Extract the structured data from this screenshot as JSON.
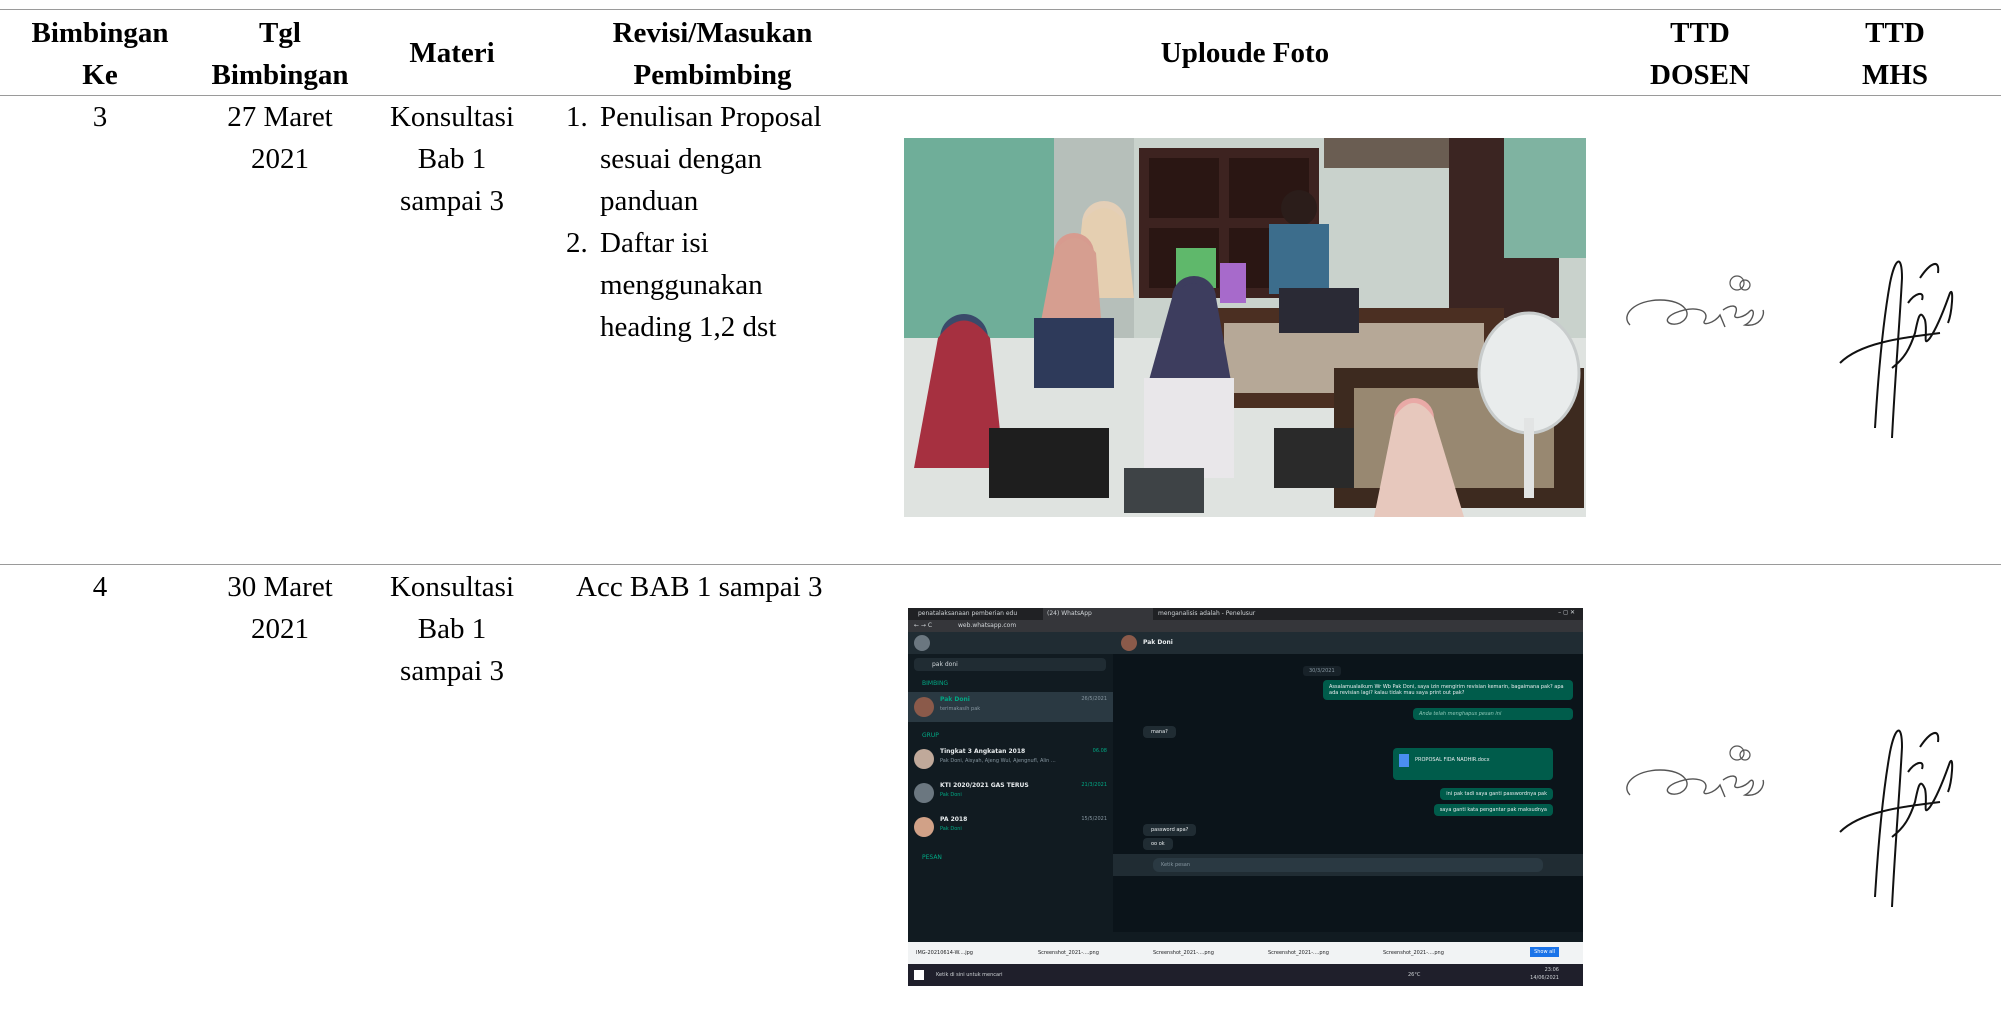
{
  "table": {
    "headers": {
      "ke": [
        "Bimbingan",
        "Ke"
      ],
      "tgl": [
        "Tgl",
        "Bimbingan"
      ],
      "materi": "Materi",
      "revisi": [
        "Revisi/Masukan",
        "Pembimbing"
      ],
      "foto": "Uploude Foto",
      "ttd_dosen": [
        "TTD",
        "DOSEN"
      ],
      "ttd_mhs": [
        "TTD",
        "MHS"
      ]
    },
    "rows": [
      {
        "ke": "3",
        "tgl": [
          "27 Maret",
          "2021"
        ],
        "materi": [
          "Konsultasi",
          "Bab 1",
          "sampai 3"
        ],
        "revisi": [
          {
            "num": "1.",
            "lines": [
              "Penulisan Proposal",
              "sesuai dengan",
              "panduan"
            ]
          },
          {
            "num": "2.",
            "lines": [
              "Daftar isi",
              "menggunakan",
              "heading 1,2 dst"
            ]
          }
        ],
        "photo_icon": "group-study-photo"
      },
      {
        "ke": "4",
        "tgl": [
          "30 Maret",
          "2021"
        ],
        "materi": [
          "Konsultasi",
          "Bab 1",
          "sampai 3"
        ],
        "revisi_text": "Acc BAB 1 sampai 3",
        "photo_icon": "whatsapp-chat-screenshot"
      }
    ]
  },
  "whatsapp": {
    "tabs": [
      "penatalaksanaan pemberian edu",
      "(24) WhatsApp",
      "menganalisis adalah - Penelusur"
    ],
    "url": "web.whatsapp.com",
    "search": "pak doni",
    "contact_name": "Pak Doni",
    "date_chip": "30/3/2021",
    "section_bimbing": "BIMBING",
    "section_grup": "GRUP",
    "section_pesan": "PESAN",
    "chats": [
      {
        "name": "Pak Doni",
        "preview": "terimakasih pak",
        "time": "26/5/2021"
      },
      {
        "name": "Tingkat 3 Angkatan 2018",
        "preview": "Pak Doni, Aisyah, Ajeng Wul, Ajengnufl, Alin ...",
        "time": "06.08"
      },
      {
        "name": "KTI 2020/2021 GAS TERUS",
        "preview": "Pak Doni",
        "time": "21/3/2021"
      },
      {
        "name": "PA 2018",
        "preview": "Pak Doni",
        "time": "15/5/2021"
      }
    ],
    "msg_out_1": "Assalamualaikum Wr Wb Pak Doni, saya izin mengirim revisian kemarin, bagaimana pak? apa ada revisian lagi? kalau tidak mau saya print out pak?",
    "msg_deleted": "Anda telah menghapus pesan ini",
    "msg_in_1": "mana?",
    "file_name": "PROPOSAL FIDA NADHIR.docx",
    "msg_out_2": "ini pak tadi saya ganti passwordnya pak",
    "msg_out_3": "saya ganti kata pengantar pak maksudnya",
    "msg_in_2": "password apa?",
    "msg_in_3": "oo ok",
    "input_placeholder": "Ketik pesan",
    "downloads": [
      "IMG-20210614-W....jpg",
      "Screenshot_2021-....png",
      "Screenshot_2021-....png",
      "Screenshot_2021-....png",
      "Screenshot_2021-....png"
    ],
    "show_all": "Show all",
    "taskbar_search": "Ketik di sini untuk mencari",
    "weather": "26°C",
    "clock_time": "23:06",
    "clock_date": "14/06/2021"
  }
}
